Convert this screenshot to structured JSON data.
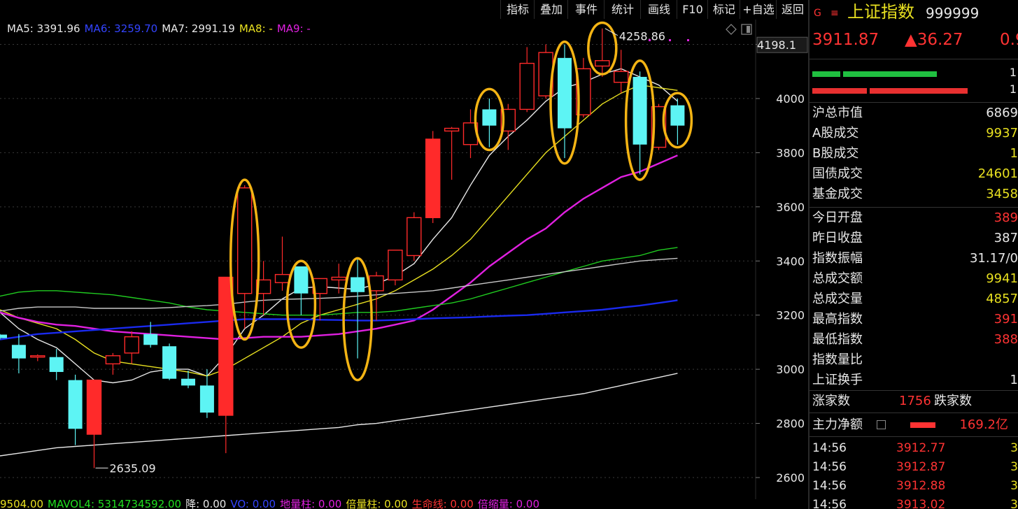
{
  "toolbar": {
    "items": [
      "指标",
      "叠加",
      "事件",
      "统计",
      "画线",
      "F10",
      "标记",
      "+自选",
      "返回"
    ]
  },
  "ma_legend": [
    {
      "label": "MA5: 3391.96",
      "color": "#e8e8e8"
    },
    {
      "label": "MA6: 3259.70",
      "color": "#3344ff"
    },
    {
      "label": "MA7: 2991.19",
      "color": "#e8e8e8"
    },
    {
      "label": "MA8: -",
      "color": "#e8e020"
    },
    {
      "label": "MA9: -",
      "color": "#e020e0"
    }
  ],
  "bottom_bar": [
    {
      "label": "9504.00",
      "color": "#e8e020"
    },
    {
      "label": "MAVOL4: 531473459​2.00",
      "color": "#20e020"
    },
    {
      "label": "降: 0.00",
      "color": "#e8e8e8"
    },
    {
      "label": "VO: 0.00",
      "color": "#3344ff"
    },
    {
      "label": "地量柱: 0.00",
      "color": "#e020e0"
    },
    {
      "label": "倍量柱: 0.00",
      "color": "#e8e020"
    },
    {
      "label": "生命线: 0.00",
      "color": "#ff3333"
    },
    {
      "label": "倍缩量: 0.00",
      "color": "#e020e0"
    }
  ],
  "panel": {
    "icon_g": "G",
    "icon_menu": "≡",
    "name": "上证指数",
    "code": "999999",
    "price": "3911.87",
    "change": "▲36.27",
    "change_pct": "0.9",
    "bar_right_1": "1",
    "bar_right_2": "1",
    "stats": [
      {
        "label": "沪总市值",
        "value": "6869",
        "color": "#e8e8e8"
      },
      {
        "label": "A股成交",
        "value": "9937",
        "color": "#e8e020"
      },
      {
        "label": "B股成交",
        "value": "1",
        "color": "#e8e020"
      },
      {
        "label": "国债成交",
        "value": "24601",
        "color": "#e8e020"
      },
      {
        "label": "基金成交",
        "value": "3458",
        "color": "#e8e020"
      }
    ],
    "stats2": [
      {
        "label": "今日开盘",
        "value": "389",
        "color": "#ff3333"
      },
      {
        "label": "昨日收盘",
        "value": "387",
        "color": "#e8e8e8"
      },
      {
        "label": "指数振幅",
        "value": "31.17/0",
        "color": "#e8e8e8"
      },
      {
        "label": "总成交额",
        "value": "9941",
        "color": "#e8e020"
      },
      {
        "label": "总成交量",
        "value": "4857",
        "color": "#e8e020"
      },
      {
        "label": "最高指数",
        "value": "391",
        "color": "#ff3333"
      },
      {
        "label": "最低指数",
        "value": "388",
        "color": "#ff3333"
      },
      {
        "label": "指数量比",
        "value": "",
        "color": "#e8e8e8"
      },
      {
        "label": "上证换手",
        "value": "1",
        "color": "#e8e8e8"
      }
    ],
    "advance_label": "涨家数",
    "advance_value": "1756",
    "decline_label": "跌家数",
    "main_flow_label": "主力净额",
    "main_flow_value": "169.2亿",
    "ticks": [
      {
        "time": "14:56",
        "price": "3912.77",
        "vol": "3"
      },
      {
        "time": "14:56",
        "price": "3912.87",
        "vol": "3"
      },
      {
        "time": "14:56",
        "price": "3912.88",
        "vol": "3"
      },
      {
        "time": "14:56",
        "price": "3913.02",
        "vol": "3"
      }
    ]
  },
  "chart_data": {
    "type": "candlestick",
    "y_ticks": [
      2600,
      2800,
      3000,
      3200,
      3400,
      3600,
      3800,
      4000,
      4200
    ],
    "current_price_label": "4198.1",
    "high_annotation": "4258.86",
    "low_annotation": "2635.09",
    "candles": [
      {
        "o": 3128,
        "h": 3130,
        "l": 3110,
        "c": 3115
      },
      {
        "o": 3090,
        "h": 3130,
        "l": 2985,
        "c": 3040
      },
      {
        "o": 3045,
        "h": 3055,
        "l": 3030,
        "c": 3050
      },
      {
        "o": 3045,
        "h": 3075,
        "l": 2960,
        "c": 2990
      },
      {
        "o": 2960,
        "h": 2980,
        "l": 2720,
        "c": 2780
      },
      {
        "o": 2760,
        "h": 2960,
        "l": 2635.09,
        "c": 2960
      },
      {
        "o": 3020,
        "h": 3060,
        "l": 2980,
        "c": 3050
      },
      {
        "o": 3060,
        "h": 3140,
        "l": 3020,
        "c": 3120
      },
      {
        "o": 3130,
        "h": 3175,
        "l": 3080,
        "c": 3090
      },
      {
        "o": 3085,
        "h": 3095,
        "l": 2960,
        "c": 2965
      },
      {
        "o": 2965,
        "h": 2995,
        "l": 2930,
        "c": 2940
      },
      {
        "o": 2940,
        "h": 3000,
        "l": 2820,
        "c": 2840
      },
      {
        "o": 2830,
        "h": 3340,
        "l": 2690,
        "c": 3340
      },
      {
        "o": 3280,
        "h": 3680,
        "l": 3150,
        "c": 3670
      },
      {
        "o": 3280,
        "h": 3400,
        "l": 3200,
        "c": 3330
      },
      {
        "o": 3320,
        "h": 3490,
        "l": 3290,
        "c": 3350
      },
      {
        "o": 3380,
        "h": 3380,
        "l": 3200,
        "c": 3280
      },
      {
        "o": 3280,
        "h": 3310,
        "l": 3180,
        "c": 3335
      },
      {
        "o": 3330,
        "h": 3390,
        "l": 3280,
        "c": 3340
      },
      {
        "o": 3340,
        "h": 3410,
        "l": 3040,
        "c": 3285
      },
      {
        "o": 3290,
        "h": 3360,
        "l": 3180,
        "c": 3345
      },
      {
        "o": 3330,
        "h": 3440,
        "l": 3310,
        "c": 3440
      },
      {
        "o": 3420,
        "h": 3580,
        "l": 3400,
        "c": 3560
      },
      {
        "o": 3560,
        "h": 3880,
        "l": 3540,
        "c": 3850
      },
      {
        "o": 3880,
        "h": 3895,
        "l": 3700,
        "c": 3890
      },
      {
        "o": 3830,
        "h": 3960,
        "l": 3780,
        "c": 3910
      },
      {
        "o": 3960,
        "h": 4000,
        "l": 3820,
        "c": 3900
      },
      {
        "o": 3880,
        "h": 3980,
        "l": 3810,
        "c": 3960
      },
      {
        "o": 3960,
        "h": 4190,
        "l": 3950,
        "c": 4130
      },
      {
        "o": 4010,
        "h": 4200,
        "l": 4000,
        "c": 4170
      },
      {
        "o": 4150,
        "h": 4200,
        "l": 3780,
        "c": 3890
      },
      {
        "o": 3940,
        "h": 4150,
        "l": 3930,
        "c": 4110
      },
      {
        "o": 4120,
        "h": 4258.86,
        "l": 4080,
        "c": 4140
      },
      {
        "o": 4060,
        "h": 4180,
        "l": 4020,
        "c": 4100
      },
      {
        "o": 4080,
        "h": 4100,
        "l": 3720,
        "c": 3830
      },
      {
        "o": 3820,
        "h": 3980,
        "l": 3810,
        "c": 3970
      },
      {
        "o": 3975,
        "h": 4000,
        "l": 3830,
        "c": 3900
      }
    ],
    "ma_series": [
      {
        "name": "MA5",
        "color": "#e8e8e8",
        "values": [
          3210,
          3150,
          3110,
          3080,
          3020,
          2960,
          2950,
          2960,
          2990,
          3000,
          3000,
          2975,
          3050,
          3150,
          3200,
          3260,
          3300,
          3305,
          3300,
          3295,
          3315,
          3345,
          3390,
          3480,
          3560,
          3680,
          3790,
          3860,
          3920,
          3990,
          4040,
          4060,
          4090,
          4110,
          4080,
          4050,
          3990
        ]
      },
      {
        "name": "MA10",
        "color": "#e8e020",
        "values": [
          3220,
          3190,
          3170,
          3150,
          3110,
          3060,
          3030,
          3020,
          3010,
          3000,
          2990,
          2975,
          3000,
          3040,
          3080,
          3120,
          3170,
          3200,
          3220,
          3240,
          3260,
          3290,
          3330,
          3370,
          3420,
          3480,
          3560,
          3640,
          3720,
          3800,
          3860,
          3920,
          3980,
          4020,
          4050,
          4040,
          4030
        ]
      },
      {
        "name": "MA20",
        "color": "#e020e0",
        "values": [
          3210,
          3190,
          3175,
          3165,
          3160,
          3150,
          3140,
          3135,
          3130,
          3125,
          3120,
          3115,
          3110,
          3115,
          3120,
          3120,
          3120,
          3125,
          3130,
          3140,
          3150,
          3165,
          3180,
          3220,
          3270,
          3320,
          3380,
          3430,
          3480,
          3520,
          3580,
          3630,
          3670,
          3710,
          3730,
          3760,
          3790
        ]
      },
      {
        "name": "MA30",
        "color": "#20cc20",
        "values": [
          3270,
          3285,
          3290,
          3290,
          3285,
          3280,
          3275,
          3265,
          3255,
          3245,
          3230,
          3220,
          3215,
          3210,
          3205,
          3200,
          3200,
          3200,
          3205,
          3210,
          3210,
          3215,
          3225,
          3235,
          3245,
          3260,
          3280,
          3300,
          3320,
          3340,
          3360,
          3380,
          3400,
          3410,
          3420,
          3440,
          3450
        ]
      },
      {
        "name": "MA60",
        "color": "#c8c8c8",
        "values": [
          3215,
          3225,
          3230,
          3230,
          3230,
          3225,
          3225,
          3225,
          3225,
          3228,
          3232,
          3235,
          3240,
          3248,
          3255,
          3258,
          3260,
          3262,
          3265,
          3270,
          3275,
          3280,
          3285,
          3290,
          3300,
          3310,
          3320,
          3330,
          3340,
          3350,
          3360,
          3370,
          3380,
          3390,
          3400,
          3405,
          3410
        ]
      },
      {
        "name": "MA120",
        "color": "#1a2aee",
        "values": [
          3110,
          3120,
          3130,
          3135,
          3140,
          3145,
          3150,
          3155,
          3160,
          3165,
          3170,
          3175,
          3180,
          3185,
          3185,
          3185,
          3185,
          3183,
          3182,
          3180,
          3180,
          3182,
          3185,
          3188,
          3190,
          3192,
          3195,
          3198,
          3200,
          3205,
          3210,
          3215,
          3220,
          3228,
          3235,
          3245,
          3255
        ]
      },
      {
        "name": "MA250",
        "color": "#e8e8e8",
        "values": [
          2680,
          2690,
          2700,
          2710,
          2715,
          2720,
          2725,
          2730,
          2735,
          2740,
          2745,
          2750,
          2755,
          2760,
          2765,
          2770,
          2775,
          2780,
          2785,
          2795,
          2800,
          2810,
          2820,
          2830,
          2840,
          2850,
          2860,
          2870,
          2880,
          2890,
          2900,
          2910,
          2925,
          2940,
          2955,
          2970,
          2985
        ]
      }
    ],
    "highlight_ellipses": [
      {
        "from": 13,
        "to": 13,
        "low": 3110,
        "high": 3700
      },
      {
        "from": 16,
        "to": 16,
        "low": 3080,
        "high": 3400
      },
      {
        "from": 19,
        "to": 19,
        "low": 2960,
        "high": 3410
      },
      {
        "from": 26,
        "to": 26,
        "low": 3810,
        "high": 4035
      },
      {
        "from": 30,
        "to": 30,
        "low": 3760,
        "high": 4210
      },
      {
        "from": 32,
        "to": 32,
        "low": 4090,
        "high": 4280
      },
      {
        "from": 34,
        "to": 34,
        "low": 3700,
        "high": 4140
      },
      {
        "from": 36,
        "to": 36,
        "low": 3820,
        "high": 4020
      }
    ]
  }
}
